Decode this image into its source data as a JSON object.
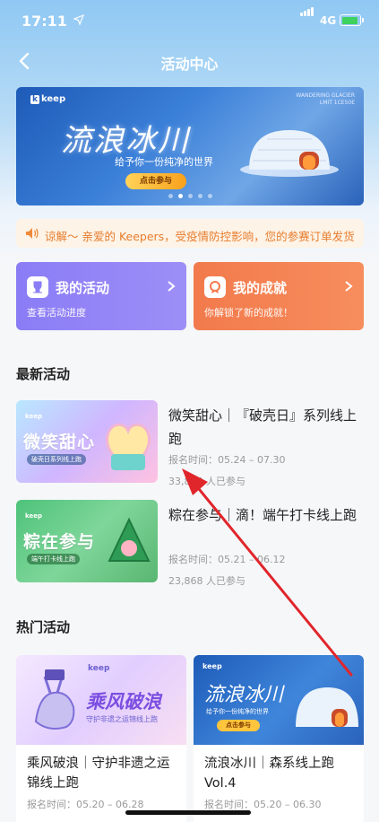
{
  "status_bar": {
    "time": "17:11",
    "network": "4G"
  },
  "nav": {
    "title": "活动中心"
  },
  "banner": {
    "logo": "keep",
    "corner_text": "WANDERING GLACIER  LMIT 1CE50E",
    "title": "流浪冰川",
    "subtitle": "给予你一份纯净的世界",
    "button": "点击参与",
    "dots": 5,
    "active_dot": 1
  },
  "notice": {
    "text": "谅解～ 亲爱的 Keepers，受疫情防控影响，您的参赛订单发货"
  },
  "cards": {
    "activity": {
      "title": "我的活动",
      "subtitle": "查看活动进度"
    },
    "achievement": {
      "title": "我的成就",
      "subtitle": "你解锁了新的成就！"
    }
  },
  "latest": {
    "heading": "最新活动",
    "items": [
      {
        "title": "微笑甜心｜『破壳日』系列线上跑",
        "date": "报名时间：05.24 – 07.30",
        "count": "33,854 人已参与",
        "thumb_text": "微笑甜心",
        "thumb_pill": "破壳日系列线上跑"
      },
      {
        "title": "粽在参与｜滴！端午打卡线上跑",
        "date": "报名时间：05.21 – 06.12",
        "count": "23,868 人已参与",
        "thumb_text": "粽在参与",
        "thumb_pill": "端午打卡线上跑"
      }
    ]
  },
  "hot": {
    "heading": "热门活动",
    "items": [
      {
        "title": "乘风破浪｜守护非遗之运锦线上跑",
        "date": "报名时间：05.20 – 06.28",
        "img_title": "乘风破浪",
        "img_sub": "守护非遗之运锦线上跑"
      },
      {
        "title": "流浪冰川｜森系线上跑Vol.4",
        "date": "报名时间：05.20 – 06.30",
        "img_title": "流浪冰川",
        "img_sub": "给予你一份纯净的世界",
        "img_button": "点击参与"
      }
    ]
  },
  "colors": {
    "activity_card": "#8a7cf5",
    "achievement_card": "#f27a4c",
    "notice_text": "#e87d2e",
    "annotation_arrow": "#e0262b"
  }
}
